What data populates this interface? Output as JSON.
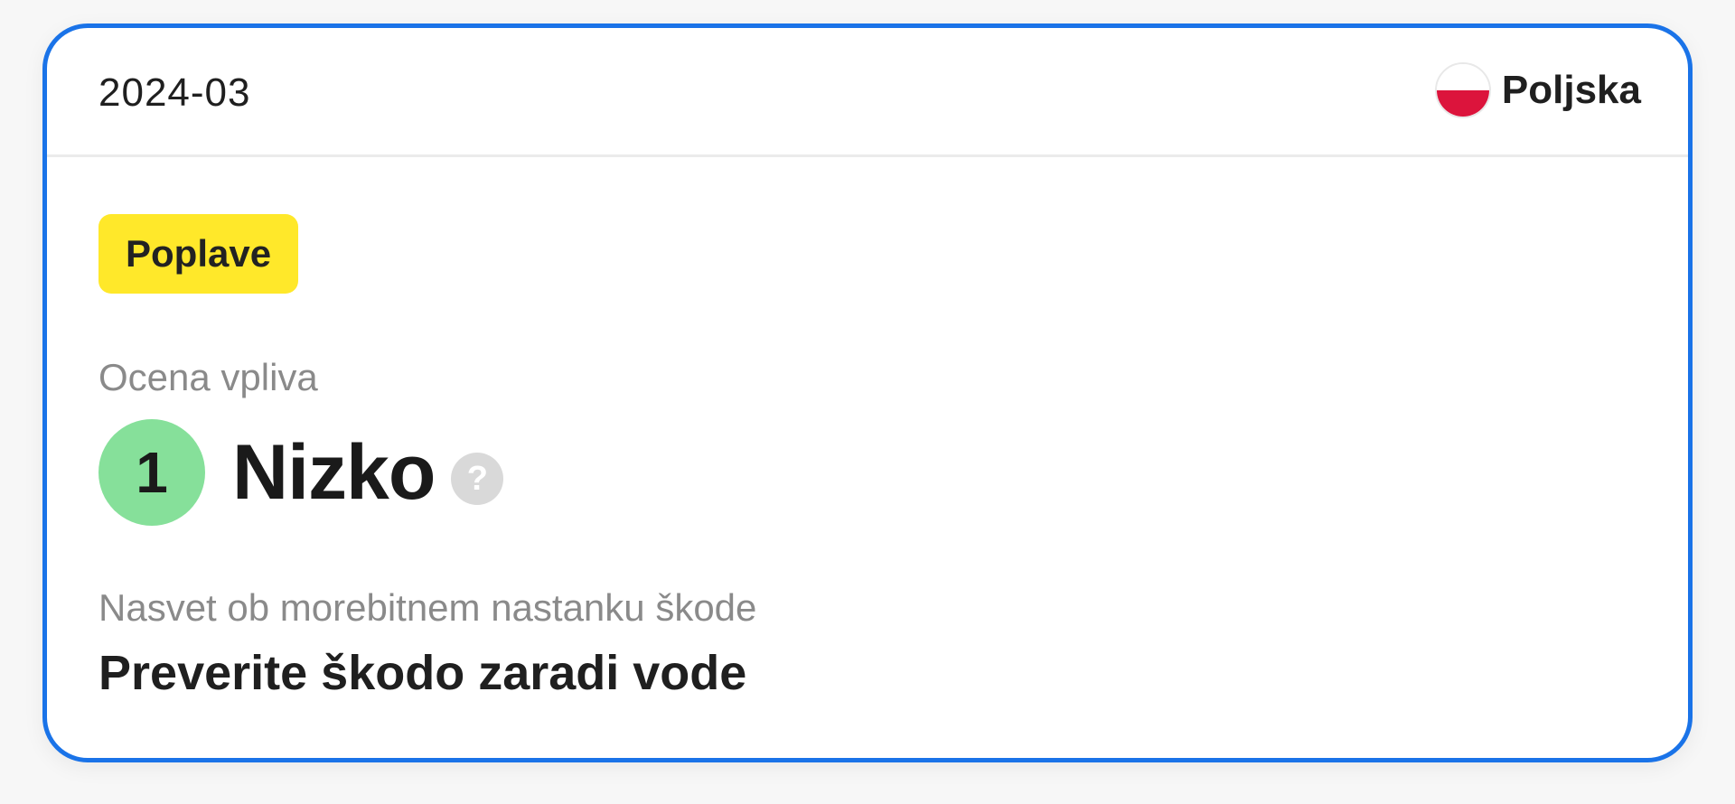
{
  "card": {
    "date": "2024-03",
    "country": {
      "name": "Poljska",
      "flag_icon": "poland-flag-icon",
      "flag_colors": [
        "#ffffff",
        "#dc143c"
      ]
    },
    "tag": {
      "label": "Poplave",
      "color": "#ffe82a"
    },
    "impact": {
      "label": "Ocena vpliva",
      "level_number": "1",
      "level_text": "Nizko",
      "level_color": "#86e09a",
      "help_icon": "question-mark-icon",
      "help_glyph": "?"
    },
    "advice": {
      "label": "Nasvet ob morebitnem nastanku škode",
      "text": "Preverite škodo zaradi vode"
    },
    "accent_color": "#1a73e8"
  }
}
